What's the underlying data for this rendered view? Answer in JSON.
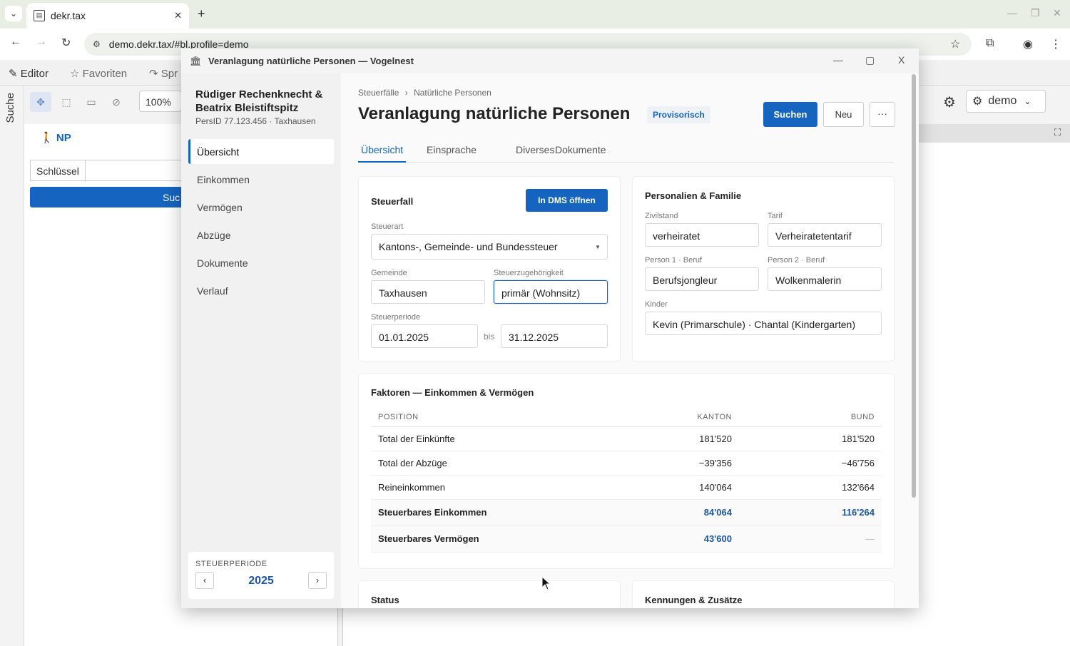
{
  "browser": {
    "tab_title": "dekr.tax",
    "url": "demo.dekr.tax/#bl.profile=demo"
  },
  "bg": {
    "menu": [
      "Editor",
      "Favoriten",
      "Spr"
    ],
    "suche_label": "Suche",
    "zoom": "100%",
    "np_label": "NP",
    "schluessel_label": "Schlüssel",
    "suchen_partial": "Suc",
    "user": "demo"
  },
  "modal": {
    "window_title": "Veranlagung natürliche Personen — Vogelnest",
    "close_glyph": "X",
    "person_name": "Rüdiger Rechenknecht & Beatrix Bleistiftspitz",
    "persid": "PersID 77.123.456 · Taxhausen",
    "nav": [
      "Übersicht",
      "Einkommen",
      "Vermögen",
      "Abzüge",
      "Dokumente",
      "Verlauf"
    ],
    "period_label": "STEUERPERIODE",
    "period_year": "2025",
    "breadcrumb": [
      "Steuerfälle",
      "Natürliche Personen"
    ],
    "title": "Veranlagung natürliche Personen",
    "status": "Provisorisch",
    "btn_suchen": "Suchen",
    "btn_neu": "Neu",
    "btn_more": "···",
    "tabs": [
      "Übersicht",
      "Einsprache",
      "Diverses",
      "Dokumente"
    ],
    "steuerfall": {
      "title": "Steuerfall",
      "btn_dms": "In DMS öffnen",
      "steuerart_label": "Steuerart",
      "steuerart": "Kantons-, Gemeinde- und Bundessteuer",
      "gemeinde_label": "Gemeinde",
      "gemeinde": "Taxhausen",
      "zugehoerigkeit_label": "Steuerzugehörigkeit",
      "zugehoerigkeit": "primär (Wohnsitz)",
      "periode_label": "Steuerperiode",
      "von": "01.01.2025",
      "bis_label": "bis",
      "bis": "31.12.2025"
    },
    "personalien": {
      "title": "Personalien & Familie",
      "zivilstand_label": "Zivilstand",
      "zivilstand": "verheiratet",
      "tarif_label": "Tarif",
      "tarif": "Verheiratetentarif",
      "p1_label": "Person 1 · Beruf",
      "p1": "Berufsjongleur",
      "p2_label": "Person 2 · Beruf",
      "p2": "Wolkenmalerin",
      "kinder_label": "Kinder",
      "kinder": "Kevin (Primarschule) · Chantal (Kindergarten)"
    },
    "faktoren": {
      "title": "Faktoren — Einkommen & Vermögen",
      "headers": [
        "POSITION",
        "KANTON",
        "BUND"
      ],
      "rows": [
        [
          "Total der Einkünfte",
          "181'520",
          "181'520"
        ],
        [
          "Total der Abzüge",
          "−39'356",
          "−46'756"
        ],
        [
          "Reineinkommen",
          "140'064",
          "132'664"
        ],
        [
          "Steuerbares Einkommen",
          "84'064",
          "116'264"
        ],
        [
          "Steuerbares Vermögen",
          "43'600",
          "—"
        ]
      ]
    },
    "status_card_title": "Status",
    "kennungen_title": "Kennungen & Zusätze"
  },
  "colors": {
    "accent": "#1565c0",
    "sidebar": "#f1f1f1"
  }
}
